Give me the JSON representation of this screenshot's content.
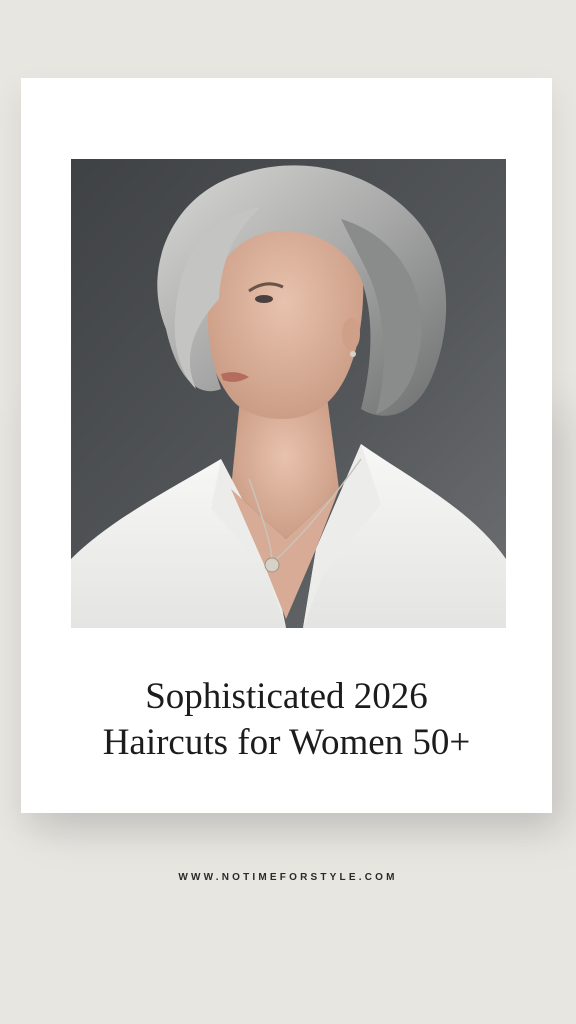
{
  "title": {
    "line1": "Sophisticated 2026",
    "line2": "Haircuts for Women 50+"
  },
  "website": "WWW.NOTIMEFORSTYLE.COM",
  "photo": {
    "icon": "portrait-photo"
  },
  "colors": {
    "background": "#e8e6e1",
    "card": "#ffffff",
    "text": "#1c1c1c"
  }
}
